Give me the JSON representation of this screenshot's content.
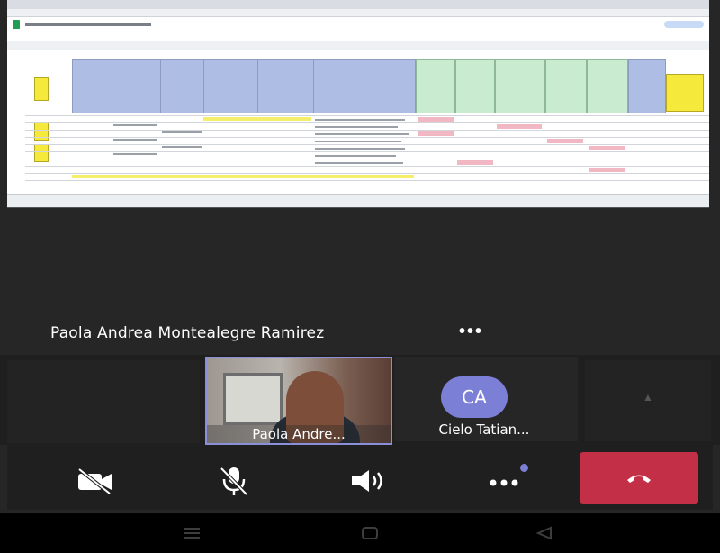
{
  "presenter": {
    "name": "Paola Andrea Montealegre Ramirez",
    "more_label": "•••"
  },
  "participants": [
    {
      "label": "Paola Andre...",
      "type": "video"
    },
    {
      "label": "Cielo Tatian...",
      "initials": "CA",
      "type": "avatar"
    }
  ],
  "controls": {
    "camera_icon": "camera-off-icon",
    "mic_icon": "mic-off-icon",
    "speaker_icon": "speaker-icon",
    "more_icon": "more-options-icon",
    "hangup_icon": "hang-up-icon"
  },
  "colors": {
    "avatar_bg": "#7b7fd6",
    "hangup_bg": "#c32f47",
    "active_tile_border": "#8b8fd9",
    "sheet_header_blue": "#aebde4",
    "sheet_header_green": "#c9ecd0",
    "sheet_highlight_yellow": "#f5ea3b"
  }
}
